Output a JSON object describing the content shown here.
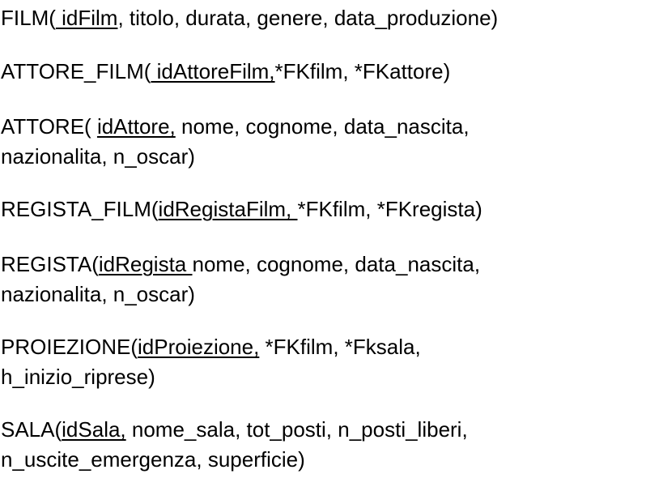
{
  "schema": [
    {
      "id": "film",
      "lines": [
        [
          {
            "text": "FILM(",
            "underline": false
          },
          {
            "text": " idFilm",
            "underline": true
          },
          {
            "text": ", titolo, durata, genere, data_produzione)",
            "underline": false
          }
        ]
      ]
    },
    {
      "id": "attore-film",
      "lines": [
        [
          {
            "text": "ATTORE_FILM(",
            "underline": false
          },
          {
            "text": " idAttoreFilm,",
            "underline": true
          },
          {
            "text": "*FKfilm, *FKattore)",
            "underline": false
          }
        ]
      ]
    },
    {
      "id": "attore",
      "lines": [
        [
          {
            "text": "ATTORE( ",
            "underline": false
          },
          {
            "text": "idAttore,",
            "underline": true
          },
          {
            "text": " nome, cognome, data_nascita,",
            "underline": false
          }
        ],
        [
          {
            "text": "nazionalita, n_oscar)",
            "underline": false
          }
        ]
      ]
    },
    {
      "id": "regista-film",
      "lines": [
        [
          {
            "text": "REGISTA_FILM(",
            "underline": false
          },
          {
            "text": "idRegistaFilm, ",
            "underline": true
          },
          {
            "text": "*FKfilm, *FKregista)",
            "underline": false
          }
        ]
      ]
    },
    {
      "id": "regista",
      "lines": [
        [
          {
            "text": "REGISTA(",
            "underline": false
          },
          {
            "text": "idRegista ",
            "underline": true
          },
          {
            "text": "nome, cognome, data_nascita,",
            "underline": false
          }
        ],
        [
          {
            "text": "nazionalita, n_oscar)",
            "underline": false
          }
        ]
      ]
    },
    {
      "id": "proiezione",
      "lines": [
        [
          {
            "text": "PROIEZIONE(",
            "underline": false
          },
          {
            "text": "idProiezione,",
            "underline": true
          },
          {
            "text": " *FKfilm, *Fksala,",
            "underline": false
          }
        ],
        [
          {
            "text": "h_inizio_riprese)",
            "underline": false
          }
        ]
      ]
    },
    {
      "id": "sala",
      "lines": [
        [
          {
            "text": "SALA(",
            "underline": false
          },
          {
            "text": "idSala,",
            "underline": true
          },
          {
            "text": " nome_sala, tot_posti, n_posti_liberi,",
            "underline": false
          }
        ],
        [
          {
            "text": "n_uscite_emergenza, superficie)",
            "underline": false
          }
        ]
      ]
    }
  ]
}
